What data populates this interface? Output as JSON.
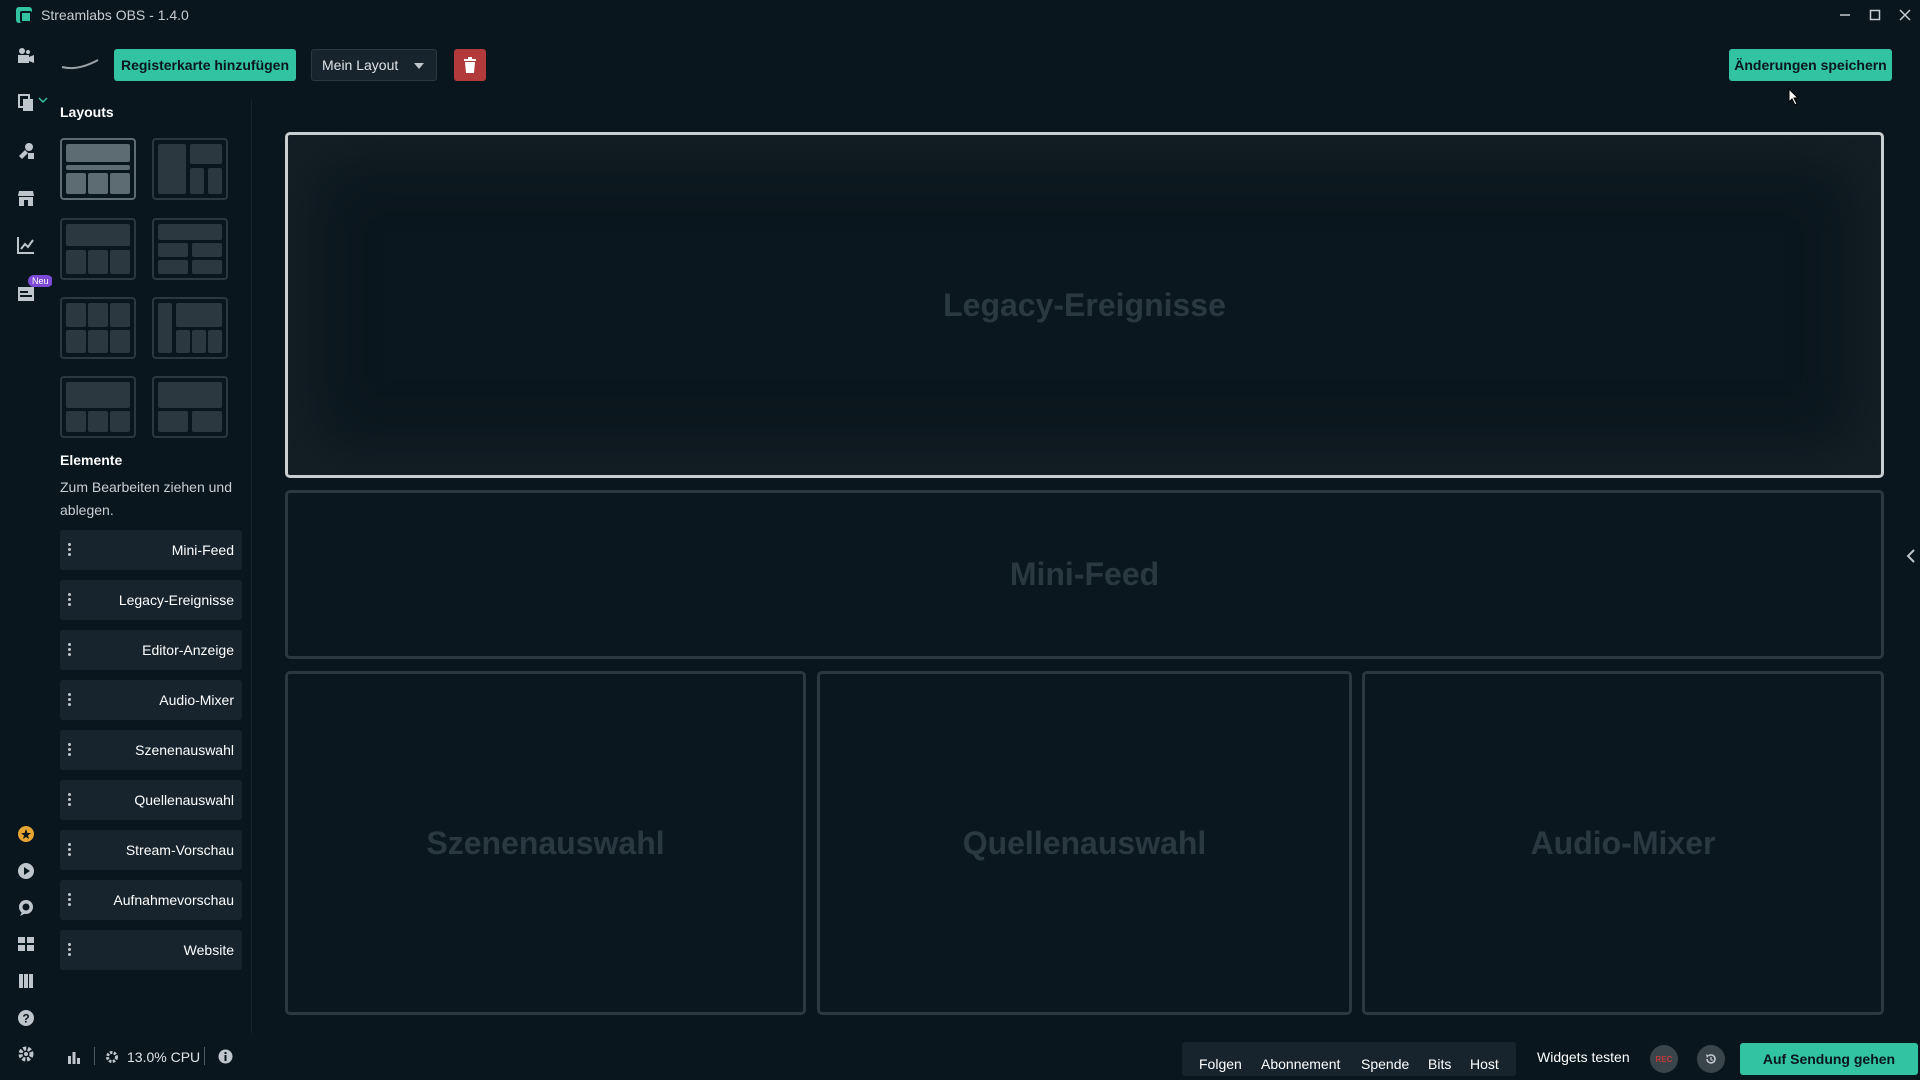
{
  "window": {
    "title": "Streamlabs OBS - 1.4.0"
  },
  "nav": {
    "new_badge": "Neu",
    "icons": [
      "editor-icon",
      "themes-icon",
      "widgets-icon",
      "store-icon",
      "dashboard-icon",
      "creator-sites-icon",
      "prime-icon",
      "record-icon",
      "chat-icon",
      "layout-editor-icon",
      "studio-mode-icon",
      "help-icon",
      "settings-icon"
    ]
  },
  "toolbar": {
    "add_tab_label": "Registerkarte hinzufügen",
    "layout_select_value": "Mein Layout",
    "save_label": "Änderungen speichern"
  },
  "panel": {
    "layouts_heading": "Layouts",
    "elements_heading": "Elemente",
    "hint": "Zum Bearbeiten ziehen und ablegen.",
    "elements": [
      "Mini-Feed",
      "Legacy-Ereignisse",
      "Editor-Anzeige",
      "Audio-Mixer",
      "Szenenauswahl",
      "Quellenauswahl",
      "Stream-Vorschau",
      "Aufnahmevorschau",
      "Website"
    ]
  },
  "canvas": {
    "slots": [
      "Legacy-Ereignisse",
      "Mini-Feed",
      "Szenenauswahl",
      "Quellenauswahl",
      "Audio-Mixer"
    ]
  },
  "footer": {
    "cpu": "13.0% CPU",
    "alerts": [
      "Folgen",
      "Abonnement",
      "Spende",
      "Bits",
      "Host"
    ],
    "test_widgets": "Widgets testen",
    "rec_label": "REC",
    "go_live": "Auf Sendung gehen"
  },
  "colors": {
    "accent": "#31c3a2",
    "background": "#09161d",
    "danger": "#b23a3a"
  }
}
